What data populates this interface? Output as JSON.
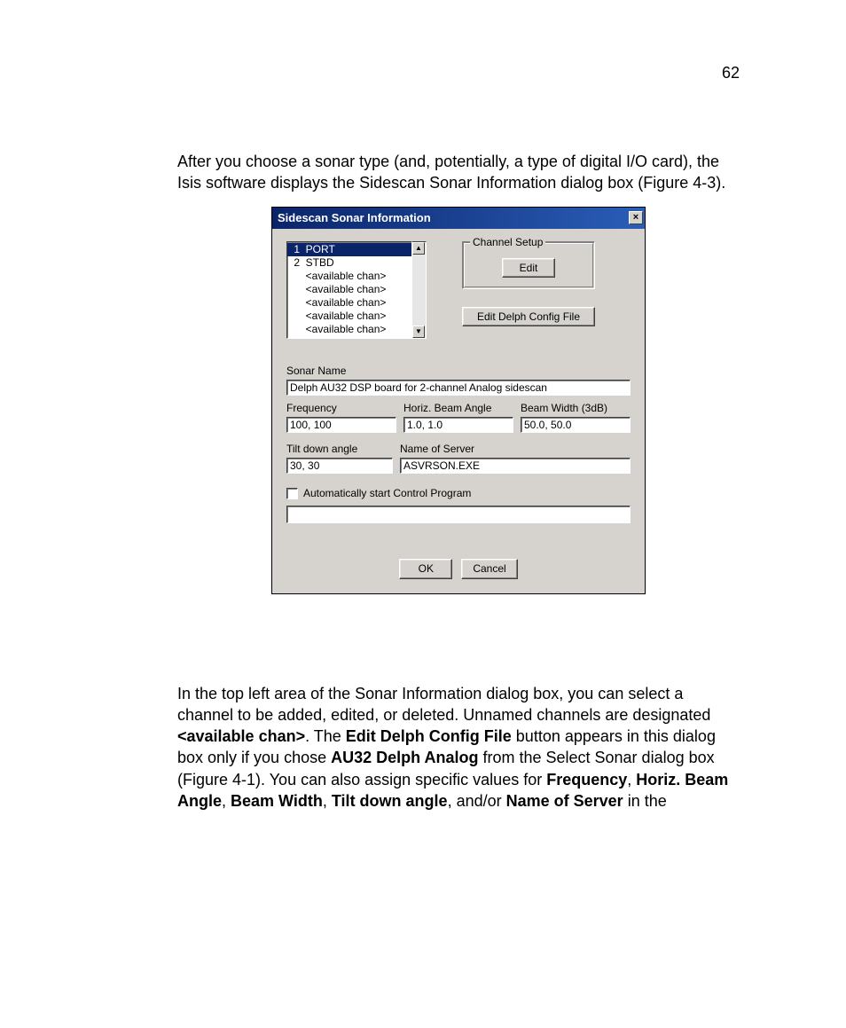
{
  "page_number": "62",
  "intro_text": "After you choose a sonar type (and, potentially, a type of digital I/O card), the Isis software displays the Sidescan Sonar Information dialog box (Figure 4-3).",
  "dialog": {
    "title": "Sidescan Sonar Information",
    "close_glyph": "×",
    "channel_list": {
      "items": [
        {
          "text": " 1  PORT",
          "selected": true
        },
        {
          "text": " 2  STBD",
          "selected": false
        },
        {
          "text": "     <available chan>",
          "selected": false
        },
        {
          "text": "     <available chan>",
          "selected": false
        },
        {
          "text": "     <available chan>",
          "selected": false
        },
        {
          "text": "     <available chan>",
          "selected": false
        },
        {
          "text": "     <available chan>",
          "selected": false
        }
      ],
      "scroll_up": "▲",
      "scroll_down": "▼"
    },
    "channel_setup": {
      "legend": "Channel Setup",
      "edit_label": "Edit"
    },
    "edit_delph_label": "Edit Delph Config File",
    "fields": {
      "sonar_name": {
        "label": "Sonar Name",
        "value": "Delph AU32 DSP board for 2-channel Analog sidescan"
      },
      "frequency": {
        "label": "Frequency",
        "value": "100, 100"
      },
      "horiz_beam_angle": {
        "label": "Horiz. Beam Angle",
        "value": "1.0, 1.0"
      },
      "beam_width": {
        "label": "Beam Width (3dB)",
        "value": "50.0, 50.0"
      },
      "tilt_down_angle": {
        "label": "Tilt down angle",
        "value": "30, 30"
      },
      "name_of_server": {
        "label": "Name of Server",
        "value": "ASVRSON.EXE"
      }
    },
    "auto_start_label": "Automatically start Control Program",
    "control_program_path": "",
    "buttons": {
      "ok": "OK",
      "cancel": "Cancel"
    }
  },
  "after": {
    "p1a": "In the top left area of the Sonar Information dialog box, you can select a channel to be added, edited, or deleted. Unnamed channels are designated ",
    "p1b": "<available chan>",
    "p1c": ". The ",
    "p1d": "Edit Delph Config File",
    "p1e": " button appears in this dialog box only if you chose ",
    "p1f": "AU32 Delph Analog",
    "p1g": " from the Select Sonar dialog box (Figure 4-1). You can also assign specific values for ",
    "p1h": "Frequency",
    "p1i": ", ",
    "p1j": "Horiz. Beam Angle",
    "p1k": ", ",
    "p1l": "Beam Width",
    "p1m": ", ",
    "p1n": "Tilt down angle",
    "p1o": ", and/or ",
    "p1p": "Name of Server",
    "p1q": " in the"
  }
}
